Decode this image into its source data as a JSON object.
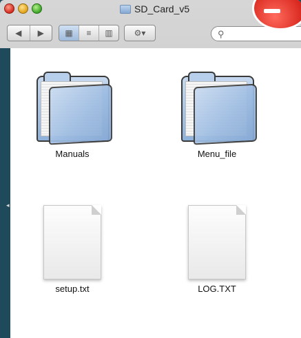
{
  "window": {
    "title": "SD_Card_v5"
  },
  "toolbar": {
    "nav_back_icon": "triangle-left",
    "nav_forward_icon": "triangle-right",
    "view_icon_label": "icon-view",
    "view_list_label": "list-view",
    "view_column_label": "column-view",
    "action_label": "gear-menu",
    "search_placeholder": ""
  },
  "items": [
    {
      "name": "Manuals",
      "type": "folder"
    },
    {
      "name": "Menu_file",
      "type": "folder"
    },
    {
      "name": "setup.txt",
      "type": "text"
    },
    {
      "name": "LOG.TXT",
      "type": "text"
    }
  ],
  "colors": {
    "desktop": "#1f4a5c",
    "folder_blue": "#9dbce2",
    "badge_red": "#d6231a"
  }
}
